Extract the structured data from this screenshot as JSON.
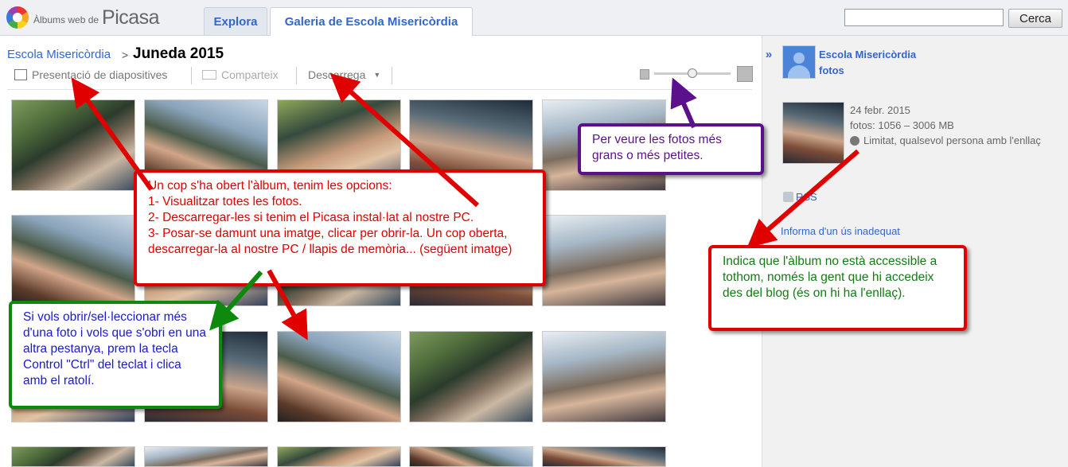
{
  "header": {
    "logo_small": "Àlbums web de",
    "logo_big": "Picasa",
    "tabs": [
      {
        "label": "Explora"
      },
      {
        "label": "Galeria de Escola Misericòrdia"
      }
    ],
    "search_button": "Cerca",
    "search_value": ""
  },
  "breadcrumb": {
    "parent": "Escola Misericòrdia",
    "separator": ">",
    "title": "Juneda 2015"
  },
  "toolbar": {
    "slideshow": "Presentació de diapositives",
    "share": "Comparteix",
    "download": "Descarrega"
  },
  "sidebar": {
    "owner_name": "Escola Misericòrdia",
    "owner_photos": "fotos",
    "date": "24 febr. 2015",
    "count": "fotos: 1056 – 3006 MB",
    "access": "Limitat, qualsevol persona amb l'enllaç",
    "rss": "RSS",
    "report": "Informa d'un ús inadequat"
  },
  "annotations": {
    "red": [
      "Un cop s'ha obert l'àlbum, tenim les opcions:",
      "1- Visualitzar totes les fotos.",
      "2- Descarregar-les si tenim el Picasa instal·lat al nostre PC.",
      "3- Posar-se damunt una imatge, clicar per obrir-la. Un cop oberta, descarregar-la al nostre PC / llapis de memòria... (següent imatge)"
    ],
    "purple": "Per veure les fotos més grans o més petites.",
    "right_green": "Indica que l'àlbum no està accessible a tothom, només la gent que hi accedeix des del blog (és on hi ha l'enllaç).",
    "left_blue": "Si vols obrir/sel·leccionar més d'una foto i vols que s'obri en una altra pestanya, prem la tecla Control \"Ctrl\" del teclat i clica amb el ratolí."
  },
  "colors": {
    "link": "#3366cc",
    "red": "#e00000",
    "purple": "#5b118c",
    "green": "#157a15"
  }
}
